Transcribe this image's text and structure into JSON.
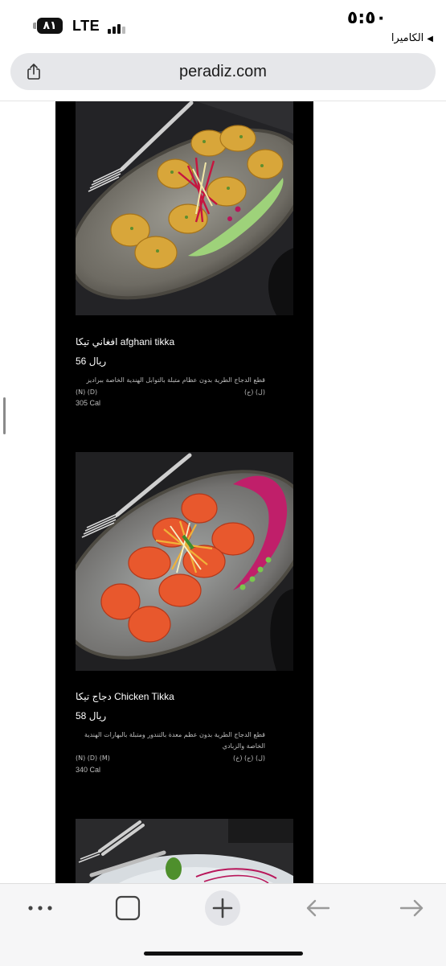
{
  "status_bar": {
    "battery": "٨١",
    "network": "LTE",
    "time": "٥:٥٠",
    "back_app": "الكاميرا"
  },
  "browser": {
    "url": "peradiz.com"
  },
  "menu_items": [
    {
      "title": "افغاني تيكا afghani tikka",
      "price": "ريال 56",
      "description": "قطع الدجاج الطرية بدون عظام متبلة بالتوابل الهندية الخاصة ببراديز",
      "allergens_en": "(N) (D)",
      "allergens_ar": "(ل) (ح)",
      "calories": "305 Cal"
    },
    {
      "title": "دجاج تيكا Chicken Tikka",
      "price": "ريال 58",
      "description": "قطع الدجاج الطرية بدون عظم معدة بالتندور ومتبلة بالبهارات الهندية الخاصة والزبادي",
      "allergens_en": "(N) (D) (M)",
      "allergens_ar": "(ل) (ح) (خ)",
      "calories": "340 Cal"
    }
  ],
  "colors": {
    "menu_background": "#000000",
    "accent_blue": "#2f6fd6"
  },
  "icons": {
    "share": "share-icon",
    "more": "more-icon",
    "tabs": "tabs-icon",
    "new_tab": "plus-icon",
    "back": "back-arrow-icon",
    "forward": "forward-arrow-icon"
  }
}
